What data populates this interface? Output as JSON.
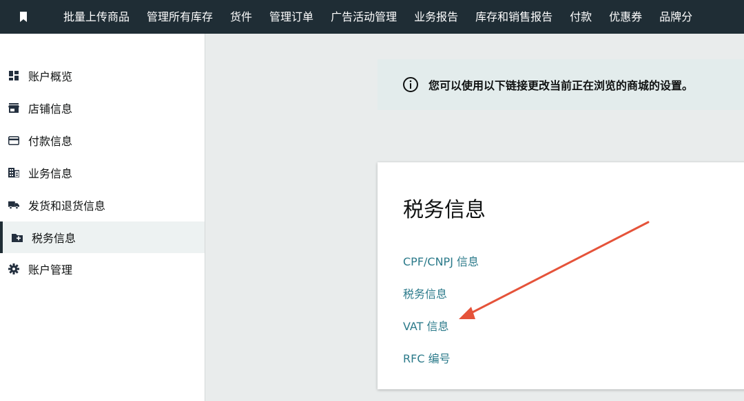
{
  "topnav": {
    "bookmark_icon": "bookmark-icon",
    "items": [
      "批量上传商品",
      "管理所有库存",
      "货件",
      "管理订单",
      "广告活动管理",
      "业务报告",
      "库存和销售报告",
      "付款",
      "优惠券",
      "品牌分"
    ]
  },
  "sidebar": {
    "items": [
      {
        "label": "账户概览",
        "icon": "dashboard-icon"
      },
      {
        "label": "店铺信息",
        "icon": "store-icon"
      },
      {
        "label": "付款信息",
        "icon": "credit-card-icon"
      },
      {
        "label": "业务信息",
        "icon": "building-icon"
      },
      {
        "label": "发货和退货信息",
        "icon": "truck-icon"
      },
      {
        "label": "税务信息",
        "icon": "folder-plus-icon"
      },
      {
        "label": "账户管理",
        "icon": "gear-icon"
      }
    ],
    "active_index": 5
  },
  "banner": {
    "icon": "info-icon",
    "text": "您可以使用以下链接更改当前正在浏览的商城的设置。"
  },
  "card": {
    "title": "税务信息",
    "links": [
      "CPF/CNPJ 信息",
      "税务信息",
      "VAT 信息",
      "RFC 编号"
    ]
  },
  "annotation": {
    "arrow_color": "#e5533a"
  },
  "colors": {
    "topbar": "#1f2d35",
    "link": "#2b7a8a",
    "banner_bg": "#e3ecec",
    "active_bg": "#edf2f2"
  }
}
